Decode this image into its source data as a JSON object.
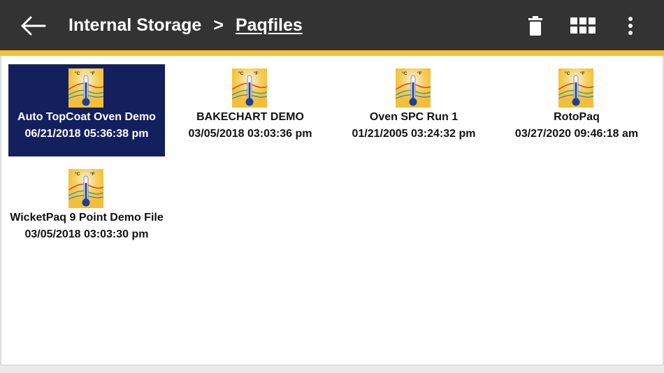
{
  "header": {
    "back_icon": "arrow-left-icon",
    "breadcrumb": {
      "root": "Internal Storage",
      "separator": ">",
      "current": "Paqfiles"
    },
    "actions": {
      "delete_icon": "trash-icon",
      "grid_icon": "grid-view-icon",
      "more_icon": "more-vertical-icon"
    },
    "accent_color": "#f3c13c",
    "bar_color": "#333333"
  },
  "files": [
    {
      "name": "Auto TopCoat Oven Demo",
      "date": "06/21/2018 05:36:38 pm",
      "selected": true
    },
    {
      "name": "BAKECHART DEMO",
      "date": "03/05/2018 03:03:36 pm",
      "selected": false
    },
    {
      "name": "Oven SPC Run 1",
      "date": "01/21/2005 03:24:32 pm",
      "selected": false
    },
    {
      "name": "RotoPaq",
      "date": "03/27/2020 09:46:18 am",
      "selected": false
    },
    {
      "name": "WicketPaq 9 Point Demo File",
      "date": "03/05/2018 03:03:30 pm",
      "selected": false
    }
  ],
  "file_icon": {
    "name": "thermometer-file-icon",
    "units_c": "°C",
    "units_f": "°F"
  },
  "selection_color": "#14205e"
}
